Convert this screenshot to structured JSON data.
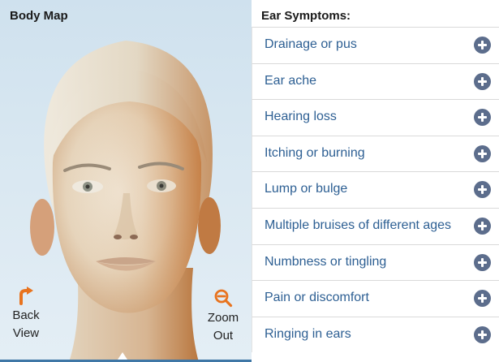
{
  "body_map": {
    "title": "Body Map",
    "back_view": {
      "line1": "Back",
      "line2": "View"
    },
    "zoom_out": {
      "line1": "Zoom",
      "line2": "Out"
    }
  },
  "symptoms": {
    "title": "Ear Symptoms:",
    "items": [
      {
        "label": "Drainage or pus"
      },
      {
        "label": "Ear ache"
      },
      {
        "label": "Hearing loss"
      },
      {
        "label": "Itching or burning"
      },
      {
        "label": "Lump or bulge"
      },
      {
        "label": "Multiple bruises of different ages"
      },
      {
        "label": "Numbness or tingling"
      },
      {
        "label": "Pain or discomfort"
      },
      {
        "label": "Ringing in ears"
      }
    ]
  },
  "colors": {
    "accent_orange": "#e8731e",
    "link_blue": "#2d5f93",
    "plus_icon": "#5c6d8c",
    "selection_bar": "#3f77a6"
  }
}
